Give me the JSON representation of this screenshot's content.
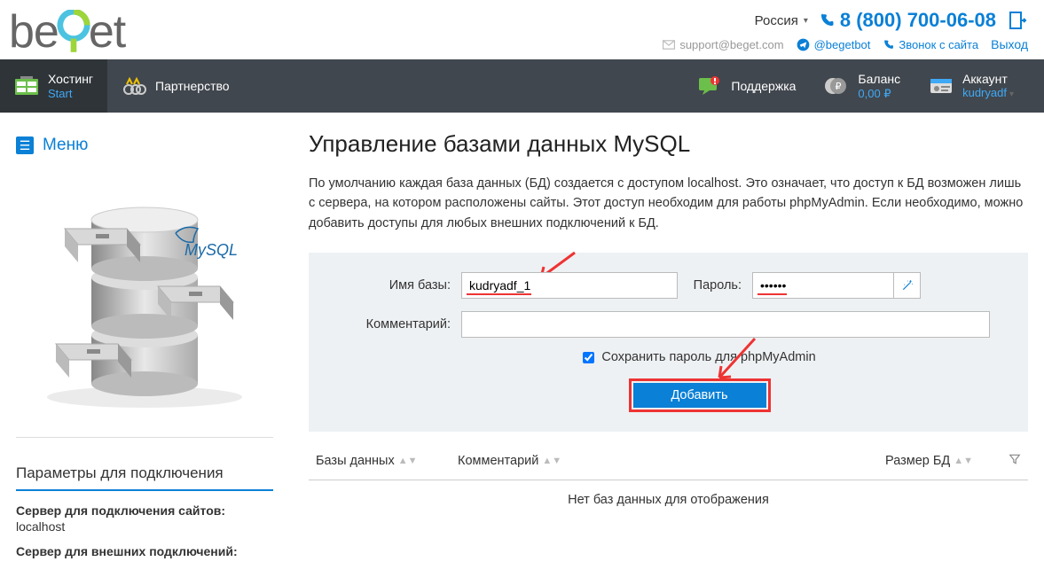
{
  "header": {
    "region": "Россия",
    "phone": "8 (800) 700-06-08",
    "support_email": "support@beget.com",
    "telegram": "@begetbot",
    "callback": "Звонок с сайта",
    "logout": "Выход"
  },
  "nav": {
    "hosting_label": "Хостинг",
    "hosting_plan": "Start",
    "partnership": "Партнерство",
    "support": "Поддержка",
    "balance_label": "Баланс",
    "balance_value": "0,00 ₽",
    "account_label": "Аккаунт",
    "account_user": "kudryadf"
  },
  "sidebar": {
    "menu": "Меню",
    "params_heading": "Параметры для подключения",
    "server_sites_label": "Сервер для подключения сайтов:",
    "server_sites_value": "localhost",
    "server_ext_label": "Сервер для внешних подключений:"
  },
  "main": {
    "title": "Управление базами данных MySQL",
    "description": "По умолчанию каждая база данных (БД) создается с доступом localhost. Это означает, что доступ к БД возможен лишь с сервера, на котором расположены сайты. Этот доступ необходим для работы phpMyAdmin. Если необходимо, можно добавить доступы для любых внешних подключений к БД.",
    "form": {
      "name_label": "Имя базы:",
      "name_value": "kudryadf_1",
      "password_label": "Пароль:",
      "password_value": "••••••",
      "comment_label": "Комментарий:",
      "comment_value": "",
      "save_checkbox": "Сохранить пароль для phpMyAdmin",
      "submit": "Добавить"
    },
    "table": {
      "col_db": "Базы данных",
      "col_comment": "Комментарий",
      "col_size": "Размер БД",
      "empty": "Нет баз данных для отображения"
    }
  }
}
